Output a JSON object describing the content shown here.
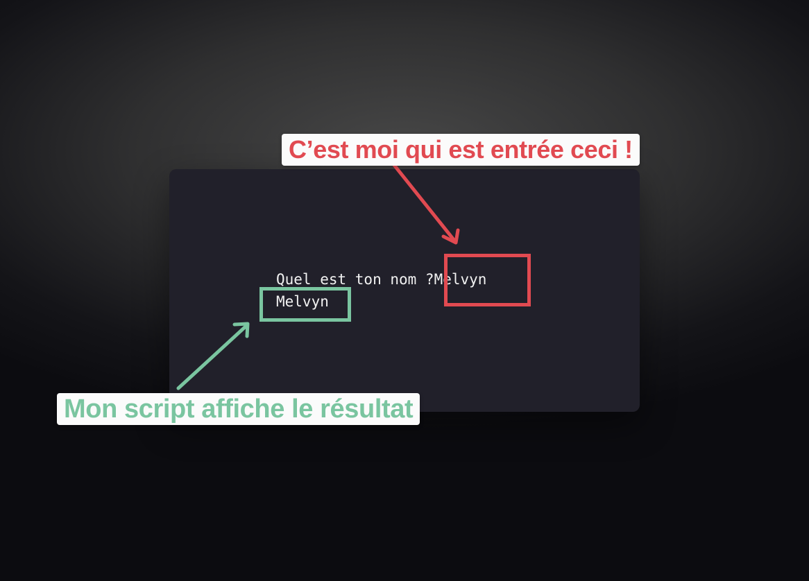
{
  "terminal": {
    "prompt_text": "Quel est ton nom ?",
    "user_input": "Melvyn",
    "output": "Melvyn"
  },
  "annotations": {
    "input_callout": {
      "text": "C’est moi qui est entrée ceci !",
      "color": "#e14a51"
    },
    "output_callout": {
      "text": "Mon script affiche le résultat",
      "color": "#7ac5a0"
    }
  },
  "colors": {
    "terminal_bg": "#21202a",
    "terminal_text": "#f2f2f2",
    "callout_bg": "#fbfbfb"
  }
}
